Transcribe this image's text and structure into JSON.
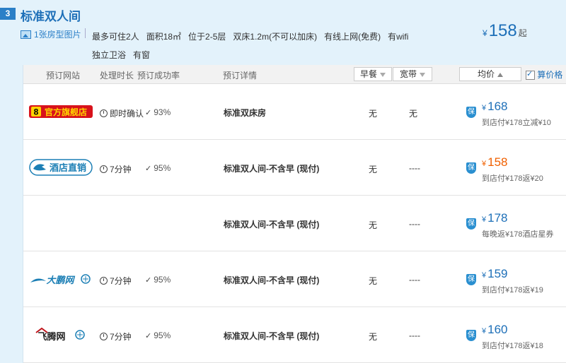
{
  "room": {
    "index": "3",
    "title": "标准双人间",
    "photo_link": "1张房型图片",
    "facilities": [
      "最多可住2人",
      "面积18㎡",
      "位于2-5层",
      "双床1.2m(不可以加床)",
      "有线上网(免费)",
      "有wifi",
      "独立卫浴",
      "有窗"
    ],
    "price_currency": "¥",
    "price": "158",
    "price_suffix": "起"
  },
  "table": {
    "headers": {
      "site": "预订网站",
      "duration": "处理时长",
      "success_rate": "预订成功率",
      "detail": "预订详情",
      "breakfast": "早餐",
      "broadband": "宽带",
      "avg_price": "均价",
      "calc_price": "算价格"
    },
    "guarantee_label": "保",
    "rows": [
      {
        "site": "官方旗舰店",
        "logo_icon": "official-store-logo",
        "duration": "即时确认",
        "rate": "93%",
        "detail": "标准双床房",
        "breakfast": "无",
        "broadband": "无",
        "currency": "¥",
        "price": "168",
        "highlight": false,
        "note": "到店付¥178立减¥10"
      },
      {
        "site": "酒店直销",
        "logo_icon": "hotel-direct-logo",
        "duration": "7分钟",
        "rate": "95%",
        "detail": "标准双人间-不含早 (现付)",
        "breakfast": "无",
        "broadband": "----",
        "currency": "¥",
        "price": "158",
        "highlight": true,
        "note": "到店付¥178返¥20"
      },
      {
        "site": "",
        "logo_icon": "",
        "duration": "",
        "rate": "",
        "detail": "标准双人间-不含早 (现付)",
        "breakfast": "无",
        "broadband": "----",
        "currency": "¥",
        "price": "178",
        "highlight": false,
        "note": "每晚返¥178酒店星券"
      },
      {
        "site": "大鹏网",
        "logo_icon": "dapeng-logo",
        "duration": "7分钟",
        "rate": "95%",
        "detail": "标准双人间-不含早 (现付)",
        "breakfast": "无",
        "broadband": "----",
        "currency": "¥",
        "price": "159",
        "highlight": false,
        "note": "到店付¥178返¥19"
      },
      {
        "site": "飞腾网",
        "logo_icon": "feiteng-logo",
        "duration": "7分钟",
        "rate": "95%",
        "detail": "标准双人间-不含早 (现付)",
        "breakfast": "无",
        "broadband": "----",
        "currency": "¥",
        "price": "160",
        "highlight": false,
        "note": "到店付¥178返¥18"
      }
    ]
  }
}
